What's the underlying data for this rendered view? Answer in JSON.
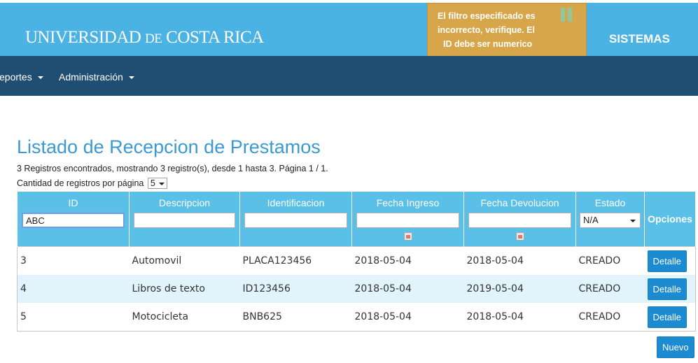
{
  "header": {
    "logo_main": "UNIVERSIDAD",
    "logo_de": "DE",
    "logo_rest": "COSTA RICA",
    "right_link": "SISTEMAS",
    "background": "#4bb2e4"
  },
  "alert": {
    "line1": "El filtro especificado es",
    "line2": "incorrecto, verifique. El",
    "line3": "ID debe ser numerico",
    "color": "#d8a64a"
  },
  "navbar": {
    "items": [
      {
        "label": "eportes"
      },
      {
        "label": "Administración"
      }
    ],
    "background": "#1f4e72"
  },
  "page": {
    "title": "Listado de Recepcion de Prestamos",
    "summary": "3 Registros encontrados, mostrando 3 registro(s), desde 1 hasta 3. Página 1 / 1.",
    "perpage_label": "Cantidad de registros por página",
    "perpage_value": "5"
  },
  "table": {
    "columns": [
      "ID",
      "Descripcion",
      "Identificacion",
      "Fecha Ingreso",
      "Fecha Devolucion",
      "Estado",
      "Opciones"
    ],
    "filters": {
      "id": "ABC",
      "descripcion": "",
      "identificacion": "",
      "fecha_ingreso": "",
      "fecha_devolucion": "",
      "estado": "N/A"
    },
    "rows": [
      {
        "id": "3",
        "descripcion": "Automovil",
        "identificacion": "PLACA123456",
        "fecha_ingreso": "2018-05-04",
        "fecha_devolucion": "2018-05-04",
        "estado": "CREADO",
        "action": "Detalle"
      },
      {
        "id": "4",
        "descripcion": "Libros de texto",
        "identificacion": "ID123456",
        "fecha_ingreso": "2018-05-04",
        "fecha_devolucion": "2019-05-04",
        "estado": "CREADO",
        "action": "Detalle"
      },
      {
        "id": "5",
        "descripcion": "Motocicleta",
        "identificacion": "BNB625",
        "fecha_ingreso": "2018-05-04",
        "fecha_devolucion": "2018-05-04",
        "estado": "CREADO",
        "action": "Detalle"
      }
    ],
    "header_color": "#5bc0e8",
    "stripe_color": "#e1f3fb"
  },
  "actions": {
    "new_label": "Nuevo",
    "button_color": "#1c8bd2"
  }
}
